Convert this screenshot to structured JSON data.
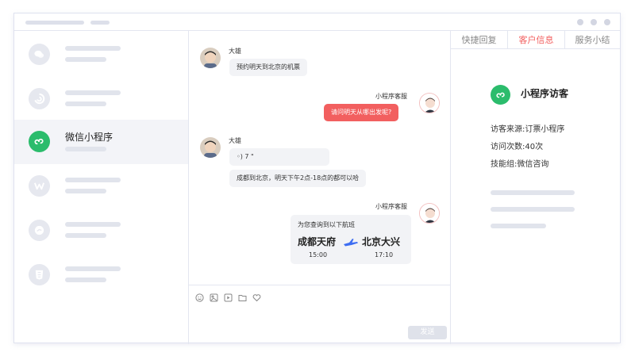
{
  "sidebar": {
    "active_label": "微信小程序"
  },
  "chat": {
    "messages": {
      "m1": {
        "sender": "大雄",
        "text": "预约明天到北京的机票"
      },
      "m2": {
        "sender": "小程序客服",
        "text": "请问明天从哪出发呢?"
      },
      "m3": {
        "sender": "大雄",
        "voice": "◦) 7 \"",
        "text": "成都到北京，明天下午2点-18点的都可以哈"
      },
      "m4": {
        "sender": "小程序客服",
        "title": "为您查询到以下航班",
        "from_city": "成都天府",
        "to_city": "北京大兴",
        "depart": "15:00",
        "arrive": "17:10"
      }
    },
    "send_label": "发送"
  },
  "panel": {
    "tabs": [
      "快捷回复",
      "客户信息",
      "服务小结"
    ],
    "active_tab": "客户信息",
    "visitor_title": "小程序访客",
    "info": [
      {
        "label": "访客来源:",
        "value": "订票小程序"
      },
      {
        "label": "访问次数:",
        "value": "40次"
      },
      {
        "label": "技能组:",
        "value": "微信咨询"
      }
    ]
  },
  "colors": {
    "accent_red": "#f25f5f",
    "wechat_green": "#2bbc6c"
  }
}
